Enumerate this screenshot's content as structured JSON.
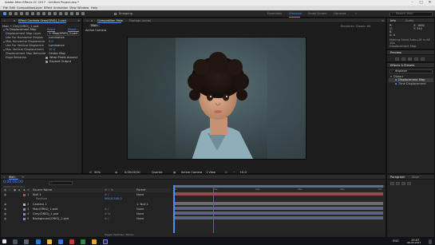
{
  "app": {
    "title": "Adobe After Effects CC 2017 - Untitled Project.aep *",
    "window_controls": {
      "minimize": "–",
      "maximize": "□",
      "close": "✕"
    }
  },
  "menu": [
    "File",
    "Edit",
    "Composition",
    "Layer",
    "Effect",
    "Animation",
    "View",
    "Window",
    "Help"
  ],
  "toolbar": {
    "snapping_label": "Snapping",
    "workspaces": [
      "Essentials",
      "Standard",
      "Small Screen",
      "Libraries"
    ],
    "active_workspace": "Standard",
    "search_placeholder": "Search Help"
  },
  "effect_controls": {
    "tab_label": "Effect Controls Grey(ORIG)_1.psd",
    "header": "Main • Grey(ORIG)_1.psd",
    "effect_name": "Displacement Map",
    "reset_label": "Reset",
    "about_label": "About...",
    "rows": [
      {
        "name": "Displacement Map Layer",
        "value": "1. Map(ORIG)_1.psd"
      },
      {
        "name": "Use For Horizontal Displac",
        "value": "Luminance"
      },
      {
        "name": "Max Horizontal Displaceme",
        "value": "0.0"
      },
      {
        "name": "Use For Vertical Displacem",
        "value": "Luminance"
      },
      {
        "name": "Max Vertical Displacement",
        "value": "10.0"
      },
      {
        "name": "Displacement Map Behavior",
        "value": "Center Map"
      },
      {
        "name": "Edge Behavior",
        "value": "Wrap Pixels Around"
      },
      {
        "name": "",
        "value": "Expand Output"
      }
    ]
  },
  "composition": {
    "tab_label": "Composition Main",
    "footage_tab": "Footage (none)",
    "breadcrumb": "Main",
    "camera_label": "Active Camera",
    "renderer": "Renderer: Classic 3D",
    "zoom": "50%",
    "timecode": "0;00;00;00",
    "quality": "Quarter",
    "camera_select": "Active Camera",
    "view_select": "1 View",
    "offset": "+0.0"
  },
  "info": {
    "tab": "Info",
    "audio_tab": "Audio",
    "lines": [
      "R:",
      "G:",
      "B:",
      "A: 0"
    ],
    "xy": [
      "X: 1680",
      "Y: 544"
    ],
    "source": "Making Great Auto-Lift in AE",
    "note1": "10s",
    "note2": "Displacement Map"
  },
  "preview": {
    "tab": "Preview"
  },
  "effects_presets": {
    "tab": "Effects & Presets",
    "search_value": "displace",
    "items": [
      "Distort",
      "Displacement Map",
      "Time Displacement"
    ]
  },
  "timeline": {
    "tab_label": "Main",
    "timecode": "0;00;00;00",
    "fps": "00000 (29.97 fps)",
    "col_source": "Source Name",
    "col_parent": "Parent",
    "ruler": [
      "0s",
      "02s",
      "04s",
      "06s",
      "08s",
      "10s"
    ],
    "toggle_label": "Toggle Switches / Modes",
    "layers": [
      {
        "num": "1",
        "name": "Null 1",
        "parent": "None",
        "color": "#d14b4b"
      },
      {
        "num": "2",
        "name": "Camera 1",
        "parent": "1. Null 1",
        "color": "#b0b0b0"
      },
      {
        "num": "3",
        "name": "Map(ORIG)_1.psd",
        "parent": "None",
        "color": "#7b8dbb"
      },
      {
        "num": "4",
        "name": "Grey(ORIG)_1.psd",
        "parent": "None",
        "color": "#7b8dbb"
      },
      {
        "num": "5",
        "name": "Background(ORIG)_1.psd",
        "parent": "None",
        "color": "#7b8dbb"
      }
    ],
    "position_label": "Position",
    "position_value": "960.0,540.0"
  },
  "paragraph": {
    "tab": "Paragraph",
    "align_tab": "Align"
  },
  "taskbar": {
    "time": "19:47",
    "date": "08-03-2017",
    "lang": "ENG"
  }
}
